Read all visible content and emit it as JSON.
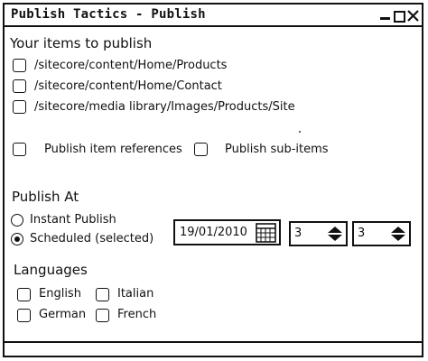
{
  "window": {
    "title": "Publish Tactics - Publish"
  },
  "items_section": {
    "title": "Your items to publish",
    "items": [
      {
        "path": "/sitecore/content/Home/Products",
        "checked": false
      },
      {
        "path": "/sitecore/content/Home/Contact",
        "checked": false
      },
      {
        "path": "/sitecore/media library/Images/Products/Site",
        "checked": false
      }
    ]
  },
  "options": {
    "publish_references": {
      "label": "Publish item references",
      "checked": false
    },
    "publish_subitems": {
      "label": "Publish sub-items",
      "checked": false
    }
  },
  "publish_at": {
    "title": "Publish At",
    "instant": {
      "label": "Instant Publish",
      "selected": false
    },
    "scheduled": {
      "label": "Scheduled (selected)",
      "selected": true
    },
    "date": "19/01/2010",
    "hour": "3",
    "minute": "3"
  },
  "languages": {
    "title": "Languages",
    "items": [
      {
        "label": "English",
        "checked": false
      },
      {
        "label": "Italian",
        "checked": false
      },
      {
        "label": "German",
        "checked": false
      },
      {
        "label": "French",
        "checked": false
      }
    ]
  },
  "icons": {
    "minimize": "minimize-icon",
    "maximize": "maximize-icon",
    "close": "close-icon",
    "calendar": "calendar-icon",
    "spinner": "spinner-arrows-icon"
  }
}
